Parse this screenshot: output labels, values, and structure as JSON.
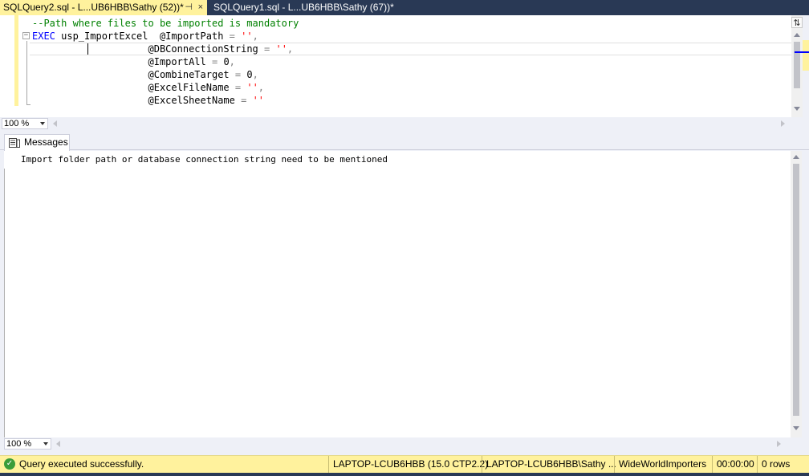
{
  "tabs": [
    {
      "label": "SQLQuery2.sql - L...UB6HBB\\Sathy (52))*",
      "active": true,
      "pin_glyph": "⊣",
      "close_glyph": "×"
    },
    {
      "label": "SQLQuery1.sql - L...UB6HBB\\Sathy (67))*",
      "active": false
    }
  ],
  "editor": {
    "fold_glyph": "−",
    "code": {
      "comment": "--Path where files to be imported is mandatory",
      "exec_kw": "EXEC",
      "proc": " usp_ImportExcel  ",
      "p1": "@ImportPath",
      "p1_op": " = ",
      "p1_val": "''",
      "p1_end": ",",
      "p2": "@DBConnectionString",
      "p2_op": " = ",
      "p2_val": "''",
      "p2_end": ",",
      "p3": "@ImportAll",
      "p3_op": " = ",
      "p3_val": "0",
      "p3_end": ",",
      "p4": "@CombineTarget",
      "p4_op": " = ",
      "p4_val": "0",
      "p4_end": ",",
      "p5": "@ExcelFileName",
      "p5_op": " = ",
      "p5_val": "''",
      "p5_end": ",",
      "p6": "@ExcelSheetName",
      "p6_op": " = ",
      "p6_val": "''"
    },
    "split_glyph": "⇅"
  },
  "zoom_top": "100 %",
  "results": {
    "tab_label": "Messages",
    "message": "Import folder path or database connection string need to be mentioned"
  },
  "zoom_bottom": "100 %",
  "status": {
    "ok_glyph": "✓",
    "text": "Query executed successfully.",
    "server": "LAPTOP-LCUB6HBB (15.0 CTP2.2)",
    "user": "LAPTOP-LCUB6HBB\\Sathy ...",
    "database": "WideWorldImporters",
    "elapsed": "00:00:00",
    "rows": "0 rows"
  },
  "colors": {
    "frame": "#293955",
    "active_tab": "#fff29d",
    "keyword": "#0000ff",
    "comment": "#008000",
    "string": "#ff0000",
    "status_ok": "#3a9d3a"
  }
}
